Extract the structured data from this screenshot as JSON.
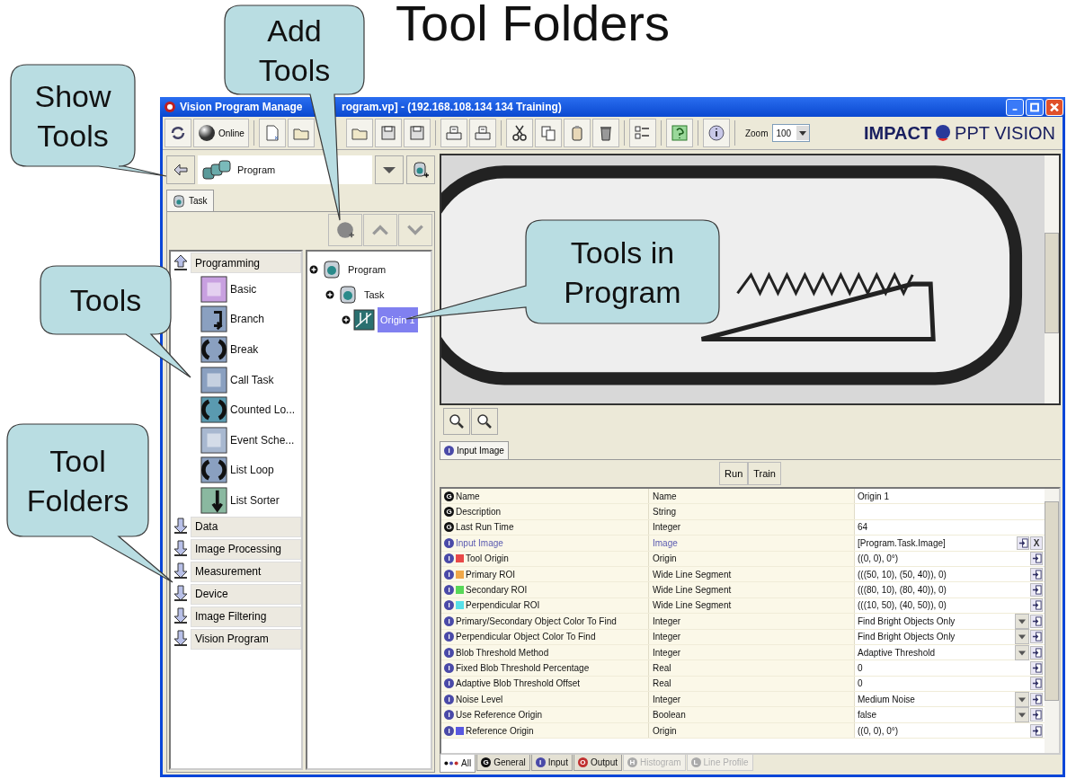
{
  "slide_title": "Tool Folders",
  "window": {
    "title_start": "Vision Program Manage",
    "title_end": "rogram.vp] - (192.168.108.134 134 Training)"
  },
  "toolbar": {
    "online_label": "Online",
    "zoom_label": "Zoom",
    "zoom_value": "100"
  },
  "logo": {
    "brand": "IMPACT",
    "product": "PPT VISION"
  },
  "program_selector": {
    "value": "Program"
  },
  "task_tab": {
    "label": "Task",
    "selected": true
  },
  "tool_folders": [
    {
      "label": "Programming",
      "expanded": true,
      "tools": [
        "Basic",
        "Branch",
        "Break",
        "Call Task",
        "Counted Lo...",
        "Event Sche...",
        "List Loop",
        "List Sorter"
      ]
    },
    {
      "label": "Data",
      "expanded": false
    },
    {
      "label": "Image Processing",
      "expanded": false
    },
    {
      "label": "Measurement",
      "expanded": false
    },
    {
      "label": "Device",
      "expanded": false
    },
    {
      "label": "Image Filtering",
      "expanded": false
    },
    {
      "label": "Vision Program",
      "expanded": false
    }
  ],
  "tree": [
    {
      "label": "Program",
      "selected": false,
      "children": [
        {
          "label": "Task",
          "selected": false,
          "children": [
            {
              "label": "Origin 1",
              "selected": true
            }
          ]
        }
      ]
    }
  ],
  "viewer_tab": {
    "label": "Input Image",
    "badge": "I"
  },
  "actions": [
    "Run",
    "Train"
  ],
  "properties": [
    {
      "kind": "general",
      "badge": "G",
      "name": "Name",
      "type": "Name",
      "value": "Origin 1",
      "linked": false,
      "dropdown": false,
      "link_button": false
    },
    {
      "kind": "general",
      "badge": "G",
      "name": "Description",
      "type": "String",
      "linked": false,
      "dropdown": false,
      "link_button": false
    },
    {
      "kind": "general",
      "badge": "G",
      "name": "Last Run Time",
      "type": "Integer",
      "value": "64",
      "linked": false,
      "dropdown": false,
      "link_button": false
    },
    {
      "kind": "input",
      "badge": "I",
      "name": "Input Image",
      "type": "Image",
      "value": "[Program.Task.Image]",
      "linked": true,
      "dropdown": false,
      "link_button": true,
      "clear_label": "X"
    },
    {
      "kind": "input",
      "badge": "I",
      "color": "#e84848",
      "name": "Tool Origin",
      "type": "Origin",
      "value": "((0, 0), 0°)",
      "linked": false,
      "dropdown": false,
      "link_button": true
    },
    {
      "kind": "input",
      "badge": "I",
      "color": "#f0a848",
      "name": "Primary ROI",
      "type": "Wide Line Segment",
      "value": "(((50, 10), (50, 40)), 0)",
      "linked": false,
      "dropdown": false,
      "link_button": true
    },
    {
      "kind": "input",
      "badge": "I",
      "color": "#58d858",
      "name": "Secondary ROI",
      "type": "Wide Line Segment",
      "value": "(((80, 10), (80, 40)), 0)",
      "linked": false,
      "dropdown": false,
      "link_button": true
    },
    {
      "kind": "input",
      "badge": "I",
      "color": "#58e0e8",
      "name": "Perpendicular ROI",
      "type": "Wide Line Segment",
      "value": "(((10, 50), (40, 50)), 0)",
      "linked": false,
      "dropdown": false,
      "link_button": true
    },
    {
      "kind": "input",
      "badge": "I",
      "name": "Primary/Secondary Object Color To Find",
      "type": "Integer",
      "value": "Find Bright Objects Only",
      "linked": false,
      "dropdown": true,
      "link_button": true
    },
    {
      "kind": "input",
      "badge": "I",
      "name": "Perpendicular Object Color To Find",
      "type": "Integer",
      "value": "Find Bright Objects Only",
      "linked": false,
      "dropdown": true,
      "link_button": true
    },
    {
      "kind": "input",
      "badge": "I",
      "name": "Blob Threshold Method",
      "type": "Integer",
      "value": "Adaptive Threshold",
      "linked": false,
      "dropdown": true,
      "link_button": true
    },
    {
      "kind": "input",
      "badge": "I",
      "name": "Fixed Blob Threshold Percentage",
      "type": "Real",
      "value": "0",
      "linked": false,
      "dropdown": false,
      "link_button": true
    },
    {
      "kind": "input",
      "badge": "I",
      "name": "Adaptive Blob Threshold Offset",
      "type": "Real",
      "value": "0",
      "linked": false,
      "dropdown": false,
      "link_button": true
    },
    {
      "kind": "input",
      "badge": "I",
      "name": "Noise Level",
      "type": "Integer",
      "value": "Medium Noise",
      "linked": false,
      "dropdown": true,
      "link_button": true
    },
    {
      "kind": "input",
      "badge": "I",
      "name": "Use Reference Origin",
      "type": "Boolean",
      "value": "false",
      "linked": false,
      "dropdown": true,
      "link_button": true
    },
    {
      "kind": "input",
      "badge": "I",
      "color": "#5858e0",
      "name": "Reference Origin",
      "type": "Origin",
      "value": "((0, 0), 0°)",
      "linked": false,
      "dropdown": false,
      "link_button": true
    }
  ],
  "bottom_tabs": [
    {
      "kind": "all",
      "label": "All",
      "selected": true,
      "disabled": false
    },
    {
      "kind": "general",
      "badge": "G",
      "label": "General",
      "selected": false,
      "disabled": false
    },
    {
      "kind": "input",
      "badge": "I",
      "label": "Input",
      "selected": false,
      "disabled": false
    },
    {
      "kind": "output",
      "badge": "O",
      "label": "Output",
      "selected": false,
      "disabled": false
    },
    {
      "kind": "histogram",
      "badge": "H",
      "label": "Histogram",
      "selected": false,
      "disabled": true
    },
    {
      "kind": "profile",
      "badge": "L",
      "label": "Line Profile",
      "selected": false,
      "disabled": true
    }
  ],
  "callouts": [
    {
      "text": "Show Tools"
    },
    {
      "text": "Add Tools"
    },
    {
      "text": "Tools"
    },
    {
      "text": "Tool Folders"
    },
    {
      "text": "Tools in Program"
    }
  ]
}
